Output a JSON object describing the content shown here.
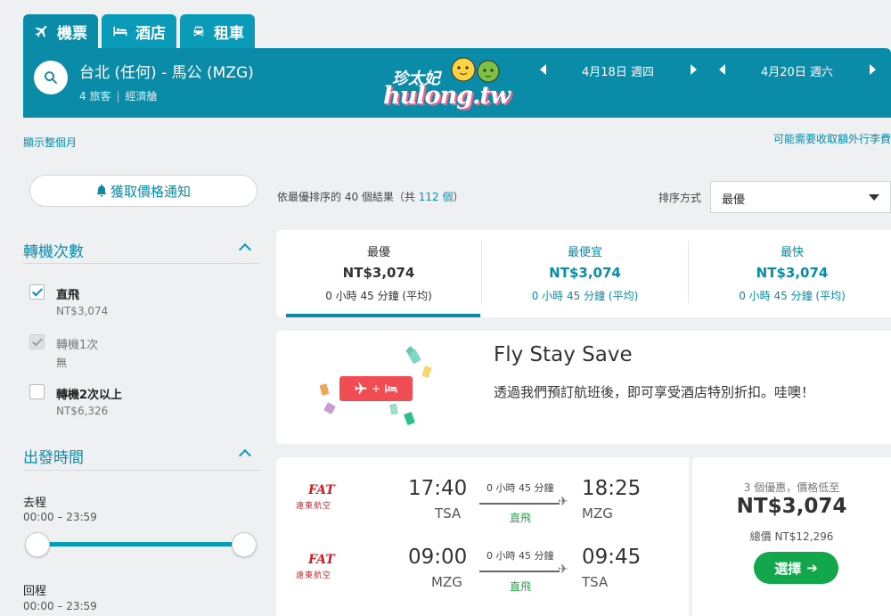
{
  "tabs": [
    {
      "label": "機票",
      "icon": "plane-icon"
    },
    {
      "label": "酒店",
      "icon": "bed-icon"
    },
    {
      "label": "租車",
      "icon": "car-icon"
    }
  ],
  "header": {
    "route": "台北 (任何) - 馬公 (MZG)",
    "travelers": "4 旅客",
    "cabin": "經濟艙",
    "depart_date": "4月18日 週四",
    "return_date": "4月20日 週六",
    "logo_cn": "珍太妃",
    "logo_en": "hulong.tw"
  },
  "links": {
    "show_month": "顯示整個月",
    "extra_fees": "可能需要收取額外行李費"
  },
  "sidebar": {
    "price_alert": "獲取價格通知",
    "stops_title": "轉機次數",
    "stops": [
      {
        "label": "直飛",
        "price": "NT$3,074",
        "state": "checked"
      },
      {
        "label": "轉機1次",
        "price": "無",
        "state": "disabled"
      },
      {
        "label": "轉機2次以上",
        "price": "NT$6,326",
        "state": "unchecked"
      }
    ],
    "departure_title": "出發時間",
    "outbound_label": "去程",
    "outbound_range": "00:00 – 23:59",
    "return_label": "回程",
    "return_range": "00:00 – 23:59"
  },
  "results": {
    "summary_prefix": "依最優排序的 40 個結果（共 ",
    "summary_total": "112 個",
    "summary_suffix": "）",
    "sort_label": "排序方式",
    "sort_value": "最優"
  },
  "sort_tabs": [
    {
      "title": "最優",
      "price": "NT$3,074",
      "duration": "0 小時 45 分鐘 (平均)"
    },
    {
      "title": "最便宜",
      "price": "NT$3,074",
      "duration": "0 小時 45 分鐘 (平均)"
    },
    {
      "title": "最快",
      "price": "NT$3,074",
      "duration": "0 小時 45 分鐘 (平均)"
    }
  ],
  "promo": {
    "title": "Fly Stay Save",
    "text": "透過我們預訂航班後，即可享受酒店特別折扣。哇噢！",
    "badge_plus": "+"
  },
  "flights": [
    {
      "airline": "FAT",
      "airline_sub": "遠東航空",
      "dep_time": "17:40",
      "dep_code": "TSA",
      "duration": "0 小時 45 分鐘",
      "stops": "直飛",
      "arr_time": "18:25",
      "arr_code": "MZG"
    },
    {
      "airline": "FAT",
      "airline_sub": "遠東航空",
      "dep_time": "09:00",
      "dep_code": "MZG",
      "duration": "0 小時 45 分鐘",
      "stops": "直飛",
      "arr_time": "09:45",
      "arr_code": "TSA"
    }
  ],
  "offer": {
    "deals": "3 個優惠，價格低至",
    "price": "NT$3,074",
    "total": "總價 NT$12,296",
    "select": "選擇",
    "select_arrow": "➔"
  },
  "colors": {
    "primary": "#0a8ca8",
    "accent_red": "#ef4d53",
    "green": "#13a74b"
  }
}
